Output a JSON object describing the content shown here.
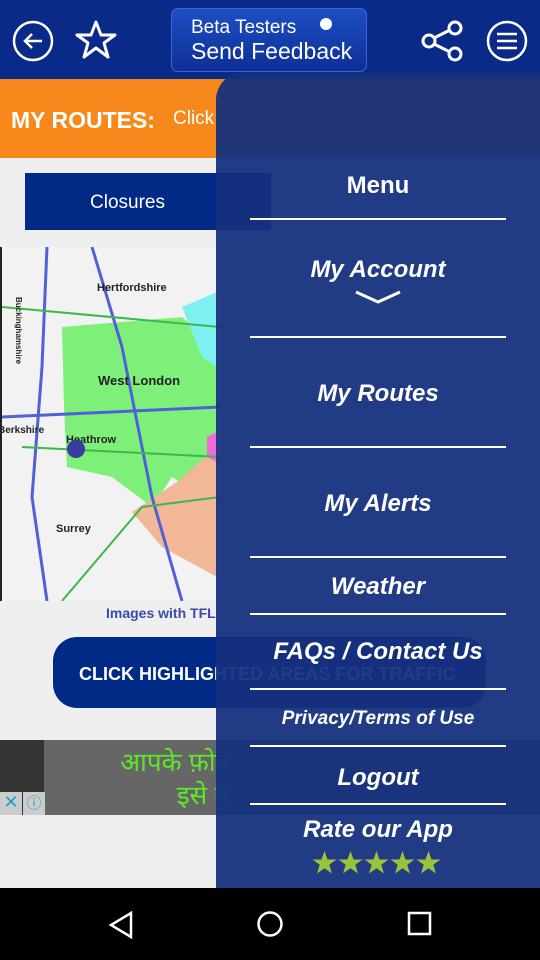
{
  "topbar": {
    "feedback_line1": "Beta Testers",
    "feedback_line2": "Send Feedback"
  },
  "banner": {
    "title": "MY ROUTES:",
    "subtitle": "Click"
  },
  "closures_label": "Closures",
  "map": {
    "labels": [
      "Hertfordshire",
      "West London",
      "Heathrow",
      "Surrey",
      "Berkshire",
      "Buckinghamshire"
    ]
  },
  "credit": "Images with TFL",
  "click_button": "CLICK HIGHLIGHTED AREAS FOR TRAFFIC",
  "ad": {
    "line1": "आपके फ़ोन",
    "line2": "इसे मु"
  },
  "drawer": {
    "title": "Menu",
    "items": [
      "My Account",
      "My Routes",
      "My Alerts",
      "Weather",
      "FAQs / Contact Us",
      "Privacy/Terms of Use",
      "Logout"
    ],
    "rate": "Rate our App",
    "stars": 5,
    "star_color": "#9cc23a"
  }
}
